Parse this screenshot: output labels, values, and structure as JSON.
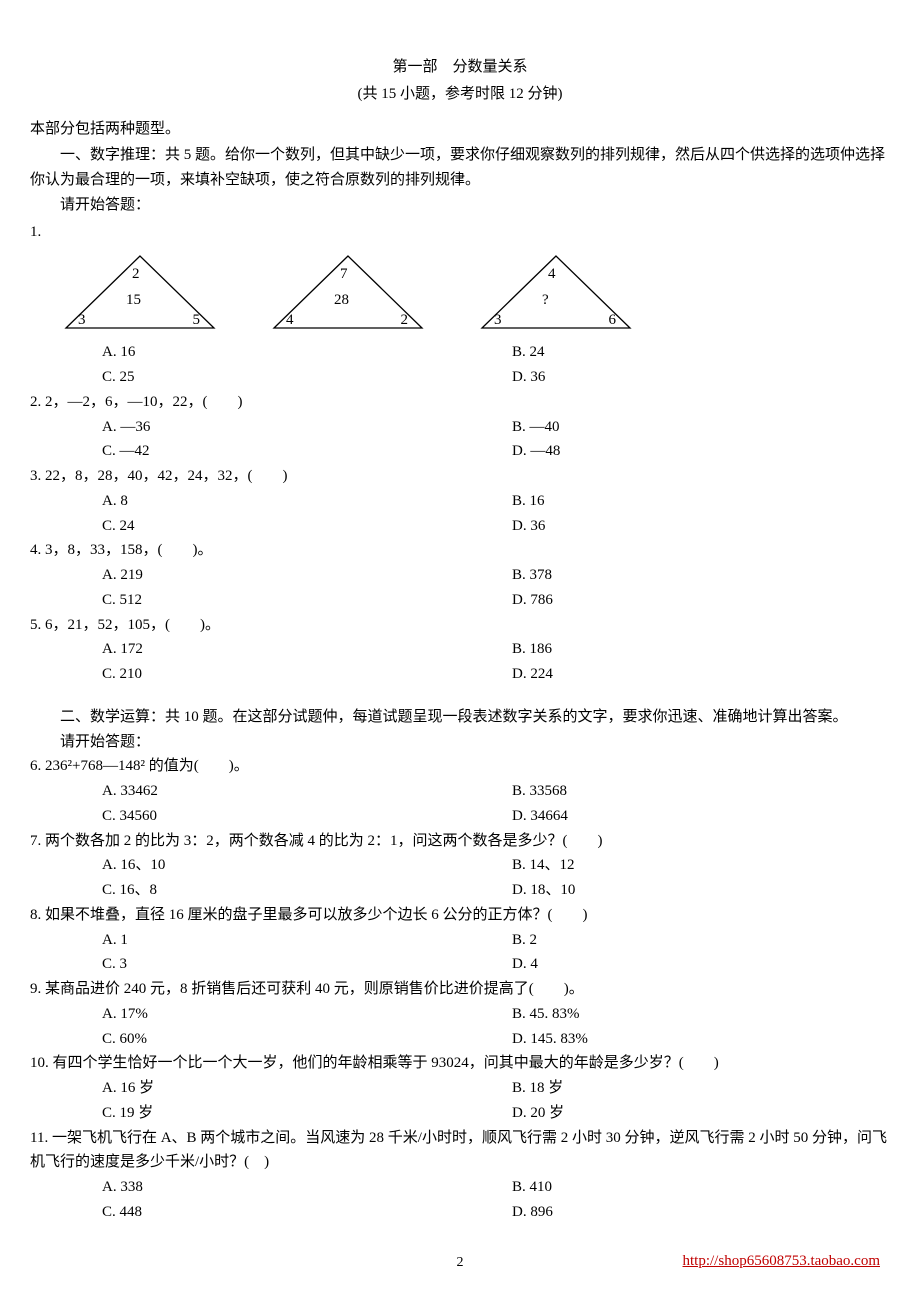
{
  "header": {
    "part_title": "第一部　分数量关系",
    "subtitle": "(共 15 小题，参考时限 12 分钟)"
  },
  "intro": {
    "line1": "本部分包括两种题型。",
    "section1": "一、数字推理：共 5 题。给你一个数列，但其中缺少一项，要求你仔细观察数列的排列规律，然后从四个供选择的选项仲选择你认为最合理的一项，来填补空缺项，使之符合原数列的排列规律。",
    "begin": "请开始答题："
  },
  "q1": {
    "num": "1.",
    "tri1": {
      "top": "2",
      "mid": "15",
      "bl": "3",
      "br": "5"
    },
    "tri2": {
      "top": "7",
      "mid": "28",
      "bl": "4",
      "br": "2"
    },
    "tri3": {
      "top": "4",
      "mid": "?",
      "bl": "3",
      "br": "6"
    },
    "A": "A. 16",
    "B": "B. 24",
    "C": "C. 25",
    "D": "D. 36"
  },
  "q2": {
    "stem": "2. 2，—2，6，—10，22，(　　)",
    "A": "A. —36",
    "B": "B. —40",
    "C": "C. —42",
    "D": "D. —48"
  },
  "q3": {
    "stem": "3. 22，8，28，40，42，24，32，(　　)",
    "A": "A. 8",
    "B": "B. 16",
    "C": "C. 24",
    "D": "D. 36"
  },
  "q4": {
    "stem": "4. 3，8，33，158，(　　)。",
    "A": "A. 219",
    "B": "B. 378",
    "C": "C. 512",
    "D": "D. 786"
  },
  "q5": {
    "stem": "5. 6，21，52，105，(　　)。",
    "A": "A. 172",
    "B": "B. 186",
    "C": "C. 210",
    "D": "D. 224"
  },
  "section2": {
    "heading": "二、数学运算：共 10 题。在这部分试题仲，每道试题呈现一段表述数字关系的文字，要求你迅速、准确地计算出答案。",
    "begin": "请开始答题："
  },
  "q6": {
    "stem": "6. 236²+768—148² 的值为(　　)。",
    "A": "A. 33462",
    "B": "B. 33568",
    "C": "C. 34560",
    "D": "D. 34664"
  },
  "q7": {
    "stem": "7. 两个数各加 2 的比为 3：2，两个数各减 4 的比为 2：1，问这两个数各是多少？(　　)",
    "A": "A. 16、10",
    "B": "B. 14、12",
    "C": "C. 16、8",
    "D": "D. 18、10"
  },
  "q8": {
    "stem": "8. 如果不堆叠，直径 16 厘米的盘子里最多可以放多少个边长 6 公分的正方体？(　　)",
    "A": "A. 1",
    "B": "B. 2",
    "C": "C. 3",
    "D": "D. 4"
  },
  "q9": {
    "stem": "9. 某商品进价 240 元，8 折销售后还可获利 40 元，则原销售价比进价提高了(　　)。",
    "A": "A. 17%",
    "B": "B. 45. 83%",
    "C": "C. 60%",
    "D": "D. 145. 83%"
  },
  "q10": {
    "stem": "10. 有四个学生恰好一个比一个大一岁，他们的年龄相乘等于 93024，问其中最大的年龄是多少岁？(　　)",
    "A": "A. 16 岁",
    "B": "B. 18 岁",
    "C": "C. 19 岁",
    "D": "D. 20 岁"
  },
  "q11": {
    "stem": "11. 一架飞机飞行在 A、B 两个城市之间。当风速为 28 千米/小时时，顺风飞行需 2 小时 30 分钟，逆风飞行需 2 小时 50 分钟，问飞机飞行的速度是多少千米/小时？(　)",
    "A": "A. 338",
    "B": "B. 410",
    "C": "C. 448",
    "D": "D. 896"
  },
  "footer": {
    "page": "2",
    "shop": "http://shop65608753.taobao.com"
  }
}
